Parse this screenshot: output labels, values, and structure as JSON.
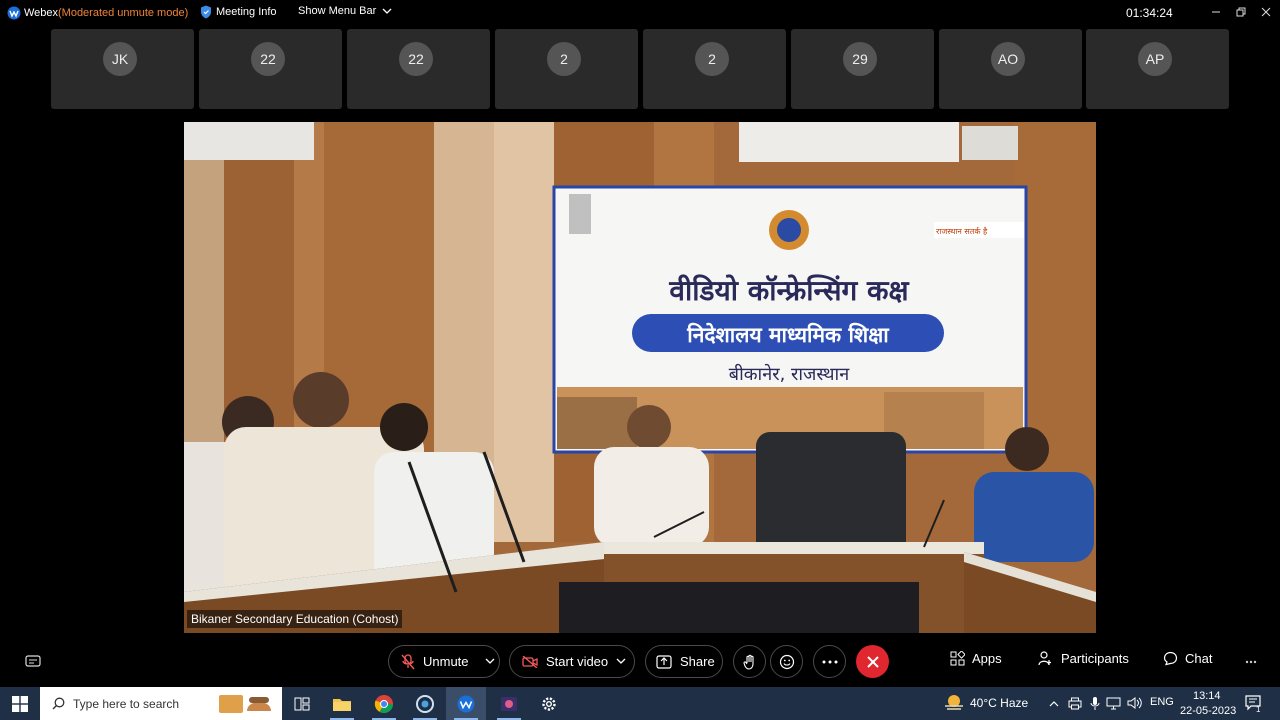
{
  "titlebar": {
    "app_name": "Webex",
    "mode": "(Moderated unmute mode)",
    "meeting_info": "Meeting Info",
    "show_menu_bar": "Show Menu Bar",
    "time": "01:34:24"
  },
  "participants": [
    {
      "initials": "JK"
    },
    {
      "initials": "22"
    },
    {
      "initials": "22"
    },
    {
      "initials": "2"
    },
    {
      "initials": "2"
    },
    {
      "initials": "29"
    },
    {
      "initials": "AO"
    },
    {
      "initials": "AP"
    }
  ],
  "main_video": {
    "speaker_label": "Bikaner Secondary Education (Cohost)",
    "banner": {
      "line1": "वीडियो कॉन्फ्रेन्सिंग कक्ष",
      "line2": "निदेशालय माध्यमिक शिक्षा",
      "line3": "बीकानेर, राजस्थान",
      "tag": "राजस्थान सतर्क है"
    }
  },
  "controls": {
    "unmute": "Unmute",
    "start_video": "Start video",
    "share": "Share",
    "apps": "Apps",
    "participants": "Participants",
    "chat": "Chat"
  },
  "taskbar": {
    "search_placeholder": "Type here to search",
    "weather": "40°C  Haze",
    "lang": "ENG",
    "clock_time": "13:14",
    "clock_date": "22-05-2023",
    "notif_count": "1"
  },
  "colors": {
    "end_call": "#e0262f",
    "mode_text": "#f0843a",
    "taskbar": "#1f2f45"
  }
}
